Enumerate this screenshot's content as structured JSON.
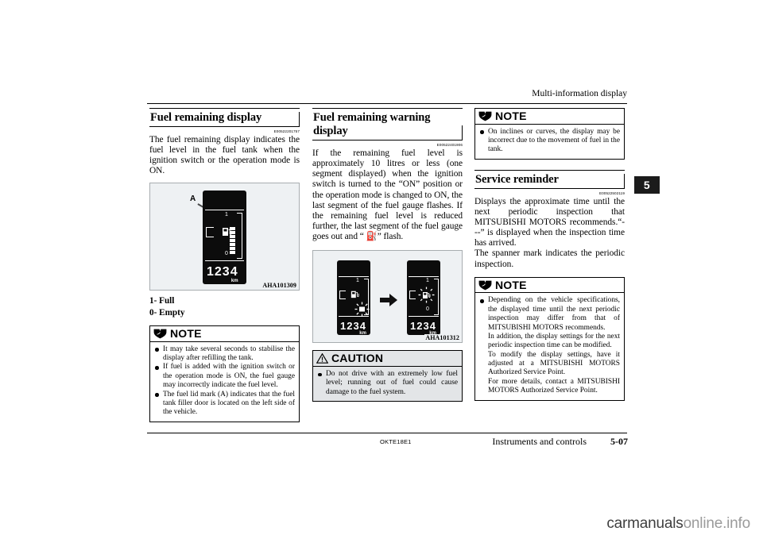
{
  "header": {
    "running_title": "Multi-information display"
  },
  "chapter_tab": {
    "number": "5"
  },
  "columns": {
    "left": {
      "heading": "Fuel remaining display",
      "refcode": "E00522201757",
      "paragraph": "The fuel remaining display indicates the fuel level in the fuel tank when the ignition switch or the operation mode is ON.",
      "figure": {
        "id": "AHA101309",
        "callout": "A",
        "gauge_top_label": "1",
        "gauge_bottom_label": "0",
        "odometer": "1234",
        "odometer_unit": "km"
      },
      "legend": [
        "1- Full",
        "0- Empty"
      ],
      "note": {
        "title": "NOTE",
        "icon": "book-icon",
        "items": [
          "It may take several seconds to stabilise the display after refilling the tank.",
          "If fuel is added with the ignition switch or the operation mode is ON, the fuel gauge may incorrectly indicate the fuel level.",
          "The fuel lid mark (A) indicates that the fuel tank filler door is located on the left side of the vehicle."
        ]
      }
    },
    "middle": {
      "heading": "Fuel remaining warning display",
      "refcode": "E00522401906",
      "paragraph": "If the remaining fuel level is approximately 10 litres or less (one segment displayed) when the ignition switch is turned to the “ON” position or the operation mode is changed to ON, the last segment of the fuel gauge flashes. If the remaining fuel level is reduced further, the last segment of the fuel gauge goes out and “ ⛽” flash.",
      "figure": {
        "id": "AHA101312",
        "left_gauge_top_label": "1",
        "right_gauge_top_label": "1",
        "right_gauge_bottom_label": "0",
        "odometer": "1234",
        "odometer_unit": "km"
      },
      "caution": {
        "title": "CAUTION",
        "icon": "warning-triangle-icon",
        "items": [
          "Do not drive with an extremely low fuel level; running out of fuel could cause damage to the fuel system."
        ]
      }
    },
    "right": {
      "note_top": {
        "title": "NOTE",
        "icon": "book-icon",
        "items": [
          "On inclines or curves, the display may be incorrect due to the movement of fuel in the tank."
        ]
      },
      "heading": "Service reminder",
      "refcode": "E00522502119",
      "paragraphs": [
        "Displays the approximate time until the next periodic inspection that MITSUBISHI MOTORS recommends.“---” is displayed when the inspection time has arrived.",
        "The spanner mark indicates the periodic inspection."
      ],
      "note_bottom": {
        "title": "NOTE",
        "icon": "book-icon",
        "items": [
          {
            "text": "Depending on the vehicle specifications, the displayed time until the next periodic inspection may differ from that of MITSUBISHI MOTORS recommends.",
            "continuations": [
              "In addition, the display settings for the next periodic inspection time can be modified.",
              "To modify the display settings, have it adjusted at a MITSUBISHI MOTORS Authorized Service Point.",
              "For more details, contact a MITSUBISHI MOTORS Authorized Service Point."
            ]
          }
        ]
      }
    }
  },
  "footer": {
    "doc_code": "OKTE18E1",
    "section": "Instruments and controls",
    "page": "5-07"
  },
  "watermark": {
    "prefix": "carmanuals",
    "suffix": "online.info"
  }
}
